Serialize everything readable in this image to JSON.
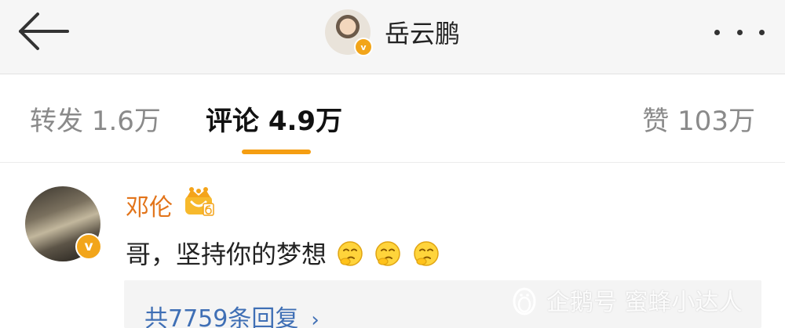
{
  "header": {
    "user_name": "岳云鹏",
    "back_icon": "arrow-left-icon",
    "more_icon": "more-dots-icon"
  },
  "tabs": [
    {
      "label": "转发 1.6万",
      "active": false
    },
    {
      "label": "评论 4.9万",
      "active": true
    },
    {
      "label": "赞 103万",
      "active": false
    }
  ],
  "comment": {
    "user_name": "邓伦",
    "text": "哥，坚持你的梦想",
    "emoji_name": "thinking-face-icon",
    "emoji_count": 3,
    "badge_icon": "crown-badge-icon",
    "replies_label": "共7759条回复",
    "replies_chevron": "›"
  },
  "watermark": {
    "text": "企鹅号 蜜蜂小达人"
  },
  "colors": {
    "accent": "#f59e12",
    "username": "#e2741a",
    "link": "#3f6fb5",
    "verified_badge": "#f2a51a"
  }
}
